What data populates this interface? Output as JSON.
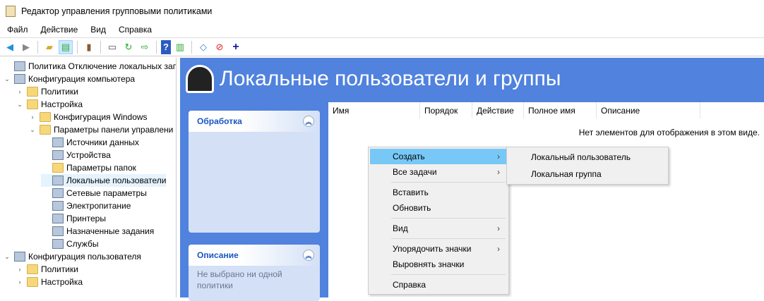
{
  "window": {
    "title": "Редактор управления групповыми политиками"
  },
  "menubar": [
    "Файл",
    "Действие",
    "Вид",
    "Справка"
  ],
  "tree": [
    {
      "label": "Политика Отключение локальных запис",
      "level": 0,
      "exp": "",
      "icon": "gen"
    },
    {
      "label": "Конфигурация компьютера",
      "level": 0,
      "exp": "⌄",
      "icon": "gen"
    },
    {
      "label": "Политики",
      "level": 1,
      "exp": "›",
      "icon": "folder"
    },
    {
      "label": "Настройка",
      "level": 1,
      "exp": "⌄",
      "icon": "folder"
    },
    {
      "label": "Конфигурация Windows",
      "level": 2,
      "exp": "›",
      "icon": "folder"
    },
    {
      "label": "Параметры панели управлени",
      "level": 2,
      "exp": "⌄",
      "icon": "folder"
    },
    {
      "label": "Источники данных",
      "level": 3,
      "exp": "",
      "icon": "gen"
    },
    {
      "label": "Устройства",
      "level": 3,
      "exp": "",
      "icon": "gen"
    },
    {
      "label": "Параметры папок",
      "level": 3,
      "exp": "",
      "icon": "folder"
    },
    {
      "label": "Локальные пользователи",
      "level": 3,
      "exp": "",
      "icon": "gen",
      "selected": true
    },
    {
      "label": "Сетевые параметры",
      "level": 3,
      "exp": "",
      "icon": "gen"
    },
    {
      "label": "Электропитание",
      "level": 3,
      "exp": "",
      "icon": "gen"
    },
    {
      "label": "Принтеры",
      "level": 3,
      "exp": "",
      "icon": "gen"
    },
    {
      "label": "Назначенные задания",
      "level": 3,
      "exp": "",
      "icon": "gen"
    },
    {
      "label": "Службы",
      "level": 3,
      "exp": "",
      "icon": "gen"
    },
    {
      "label": "Конфигурация пользователя",
      "level": 0,
      "exp": "⌄",
      "icon": "gen"
    },
    {
      "label": "Политики",
      "level": 1,
      "exp": "›",
      "icon": "folder"
    },
    {
      "label": "Настройка",
      "level": 1,
      "exp": "›",
      "icon": "folder"
    }
  ],
  "header": {
    "title": "Локальные пользователи и группы"
  },
  "tasks": {
    "processing": "Обработка",
    "description": "Описание",
    "description_text": "Не выбрано ни одной политики"
  },
  "list": {
    "columns": [
      "Имя",
      "Порядок",
      "Действие",
      "Полное имя",
      "Описание"
    ],
    "empty": "Нет элементов для отображения в этом виде."
  },
  "context_menu": [
    {
      "label": "Создать",
      "sub": true,
      "hl": true
    },
    {
      "label": "Все задачи",
      "sub": true
    },
    {
      "sep": true
    },
    {
      "label": "Вставить"
    },
    {
      "label": "Обновить"
    },
    {
      "sep": true
    },
    {
      "label": "Вид",
      "sub": true
    },
    {
      "sep": true
    },
    {
      "label": "Упорядочить значки",
      "sub": true
    },
    {
      "label": "Выровнять значки"
    },
    {
      "sep": true
    },
    {
      "label": "Справка"
    }
  ],
  "submenu": [
    "Локальный пользователь",
    "Локальная группа"
  ]
}
